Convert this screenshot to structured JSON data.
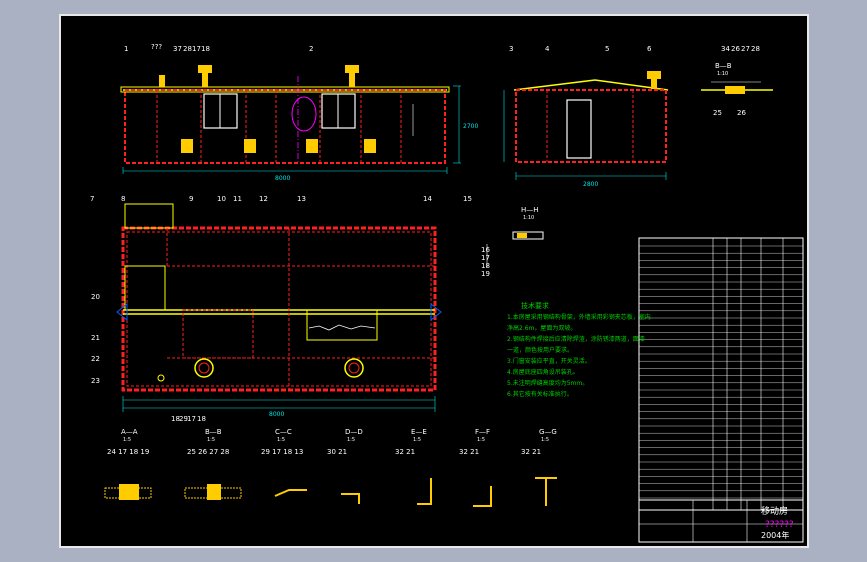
{
  "balloons": {
    "front": [
      "1",
      "???",
      "37",
      "28",
      "17",
      "18",
      "2"
    ],
    "side": [
      "3",
      "4",
      "5",
      "6"
    ],
    "detail_b": [
      "34",
      "26",
      "27",
      "28",
      "25",
      "26"
    ],
    "plan_top": [
      "7",
      "8",
      "9",
      "10",
      "11",
      "12",
      "13",
      "14",
      "15"
    ],
    "plan_left": [
      "20",
      "21",
      "22",
      "23"
    ],
    "plan_bottom": [
      "18",
      "29",
      "17",
      "18"
    ],
    "detail_h": [
      "16",
      "17",
      "18",
      "19"
    ]
  },
  "section_labels": {
    "b_b_top": "B—B",
    "h_h": "H—H",
    "a_a": "A—A",
    "b_b": "B—B",
    "c_c": "C—C",
    "d_d": "D—D",
    "e_e": "E—E",
    "f_f": "F—F",
    "g_g": "G—G"
  },
  "section_scales": {
    "b_b_top": "1:10",
    "h_h": "1:10",
    "a_a": "1:5",
    "b_b": "1:5",
    "c_c": "1:5",
    "d_d": "1:5",
    "e_e": "1:5",
    "f_f": "1:5",
    "g_g": "1:5"
  },
  "section_balloons": {
    "a": "24 17 18 19",
    "b": "25 26 27 28",
    "c": "29 17 18 13",
    "d": "30 21",
    "e": "32 21",
    "f": "32 21",
    "g": "32 21"
  },
  "notes": {
    "title": "技术要求",
    "lines": [
      "1.本房屋采用钢结构骨架，外墙采用彩钢夹芯板，室内",
      "  净高2.6m，屋面为双坡。",
      "2.钢结构件焊接后应清除焊渣，涂防锈漆两道，面漆",
      "  一道，颜色按用户要求。",
      "3.门窗安装应平直，开关灵活。",
      "4.房屋底座四角设吊装孔。",
      "5.未注明焊缝高度均为5mm。",
      "6.其它按有关标准执行。"
    ]
  },
  "title_block": {
    "company": "??????",
    "name": "移动房",
    "date": "2004年"
  },
  "dimensions": {
    "front_total": "8000",
    "side_total": "2800",
    "plan_total": "8000",
    "height": "2700"
  },
  "colors": {
    "background": "#000000",
    "frame": "#e8e8e8",
    "outline": "#ffff00",
    "wall": "#ff2020",
    "dim": "#00e5e5",
    "text": "#ffffff",
    "leader": "#ffffff",
    "accent": "#ff00ff",
    "green": "#00d000"
  }
}
